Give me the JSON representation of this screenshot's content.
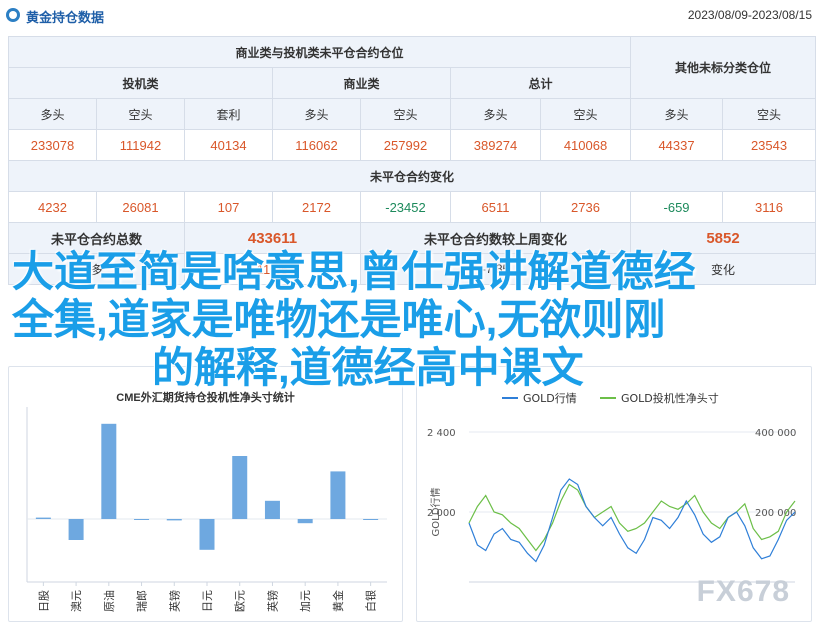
{
  "header": {
    "title": "黄金持仓数据",
    "date_range": "2023/08/09-2023/08/15"
  },
  "table": {
    "group_header": "商业类与投机类未平仓合约仓位",
    "other_header": "其他未标分类仓位",
    "sub_groups": [
      "投机类",
      "商业类",
      "总计"
    ],
    "cols": [
      "多头",
      "空头",
      "套利",
      "多头",
      "空头",
      "多头",
      "空头",
      "多头",
      "空头"
    ],
    "values": [
      "233078",
      "111942",
      "40134",
      "116062",
      "257992",
      "389274",
      "410068",
      "44337",
      "23543"
    ],
    "change_header": "未平仓合约变化",
    "changes": [
      "4232",
      "26081",
      "107",
      "2172",
      "-23452",
      "6511",
      "2736",
      "-659",
      "3116"
    ],
    "oi_total_label": "未平仓合约总数",
    "oi_total_value": "433611",
    "oi_change_label": "未平仓合约数较上周变化",
    "oi_change_value": "5852",
    "row6_left_label": "多",
    "row6_left_value": "11.05",
    "row6_mid_value": "-7.85",
    "row6_right_label": "变化"
  },
  "overlay": {
    "line1": "大道至简是啥意思,曾仕强讲解道德经",
    "line2": "全集,道家是唯物还是唯心,无欲则刚",
    "line3": "的解释,道德经高中课文"
  },
  "watermark": "FX678",
  "left_chart": {
    "chart_data": {
      "type": "bar",
      "title": "CME外汇期货持仓投机性净头寸统计",
      "categories": [
        "日股",
        "澳元",
        "原油",
        "瑞郎",
        "英镑",
        "日元",
        "欧元",
        "英镑",
        "加元",
        "黄金",
        "白银"
      ],
      "values": [
        1,
        -15,
        68,
        0,
        -1,
        -22,
        45,
        13,
        -3,
        34,
        0
      ],
      "ylim": [
        -45,
        80
      ],
      "bar_color": "#6ea8e0"
    }
  },
  "right_chart": {
    "chart_data": {
      "type": "line",
      "legend": [
        "GOLD行情",
        "GOLD投机性净头寸"
      ],
      "left_axis_label": "GOLD行情",
      "left_ticks": [
        "2 400",
        "2 000"
      ],
      "right_ticks": [
        "400 000",
        "200 000"
      ],
      "series_colors": [
        "#2f7fd8",
        "#6cbf48"
      ],
      "gold_price": [
        1980,
        1940,
        1930,
        1960,
        1970,
        1950,
        1945,
        1925,
        1910,
        1940,
        1990,
        2040,
        2060,
        2050,
        2010,
        1990,
        1975,
        1990,
        1960,
        1935,
        1925,
        1950,
        1990,
        1985,
        1970,
        1990,
        2020,
        1995,
        1960,
        1945,
        1955,
        1990,
        2000,
        1975,
        1935,
        1915,
        1920,
        1950,
        1985,
        2000
      ],
      "net_position": [
        180000,
        210000,
        230000,
        200000,
        195000,
        180000,
        170000,
        150000,
        130000,
        150000,
        180000,
        220000,
        250000,
        240000,
        210000,
        190000,
        200000,
        210000,
        180000,
        165000,
        170000,
        180000,
        200000,
        220000,
        210000,
        205000,
        215000,
        230000,
        200000,
        180000,
        170000,
        190000,
        200000,
        215000,
        170000,
        150000,
        155000,
        165000,
        200000,
        220000
      ]
    }
  }
}
